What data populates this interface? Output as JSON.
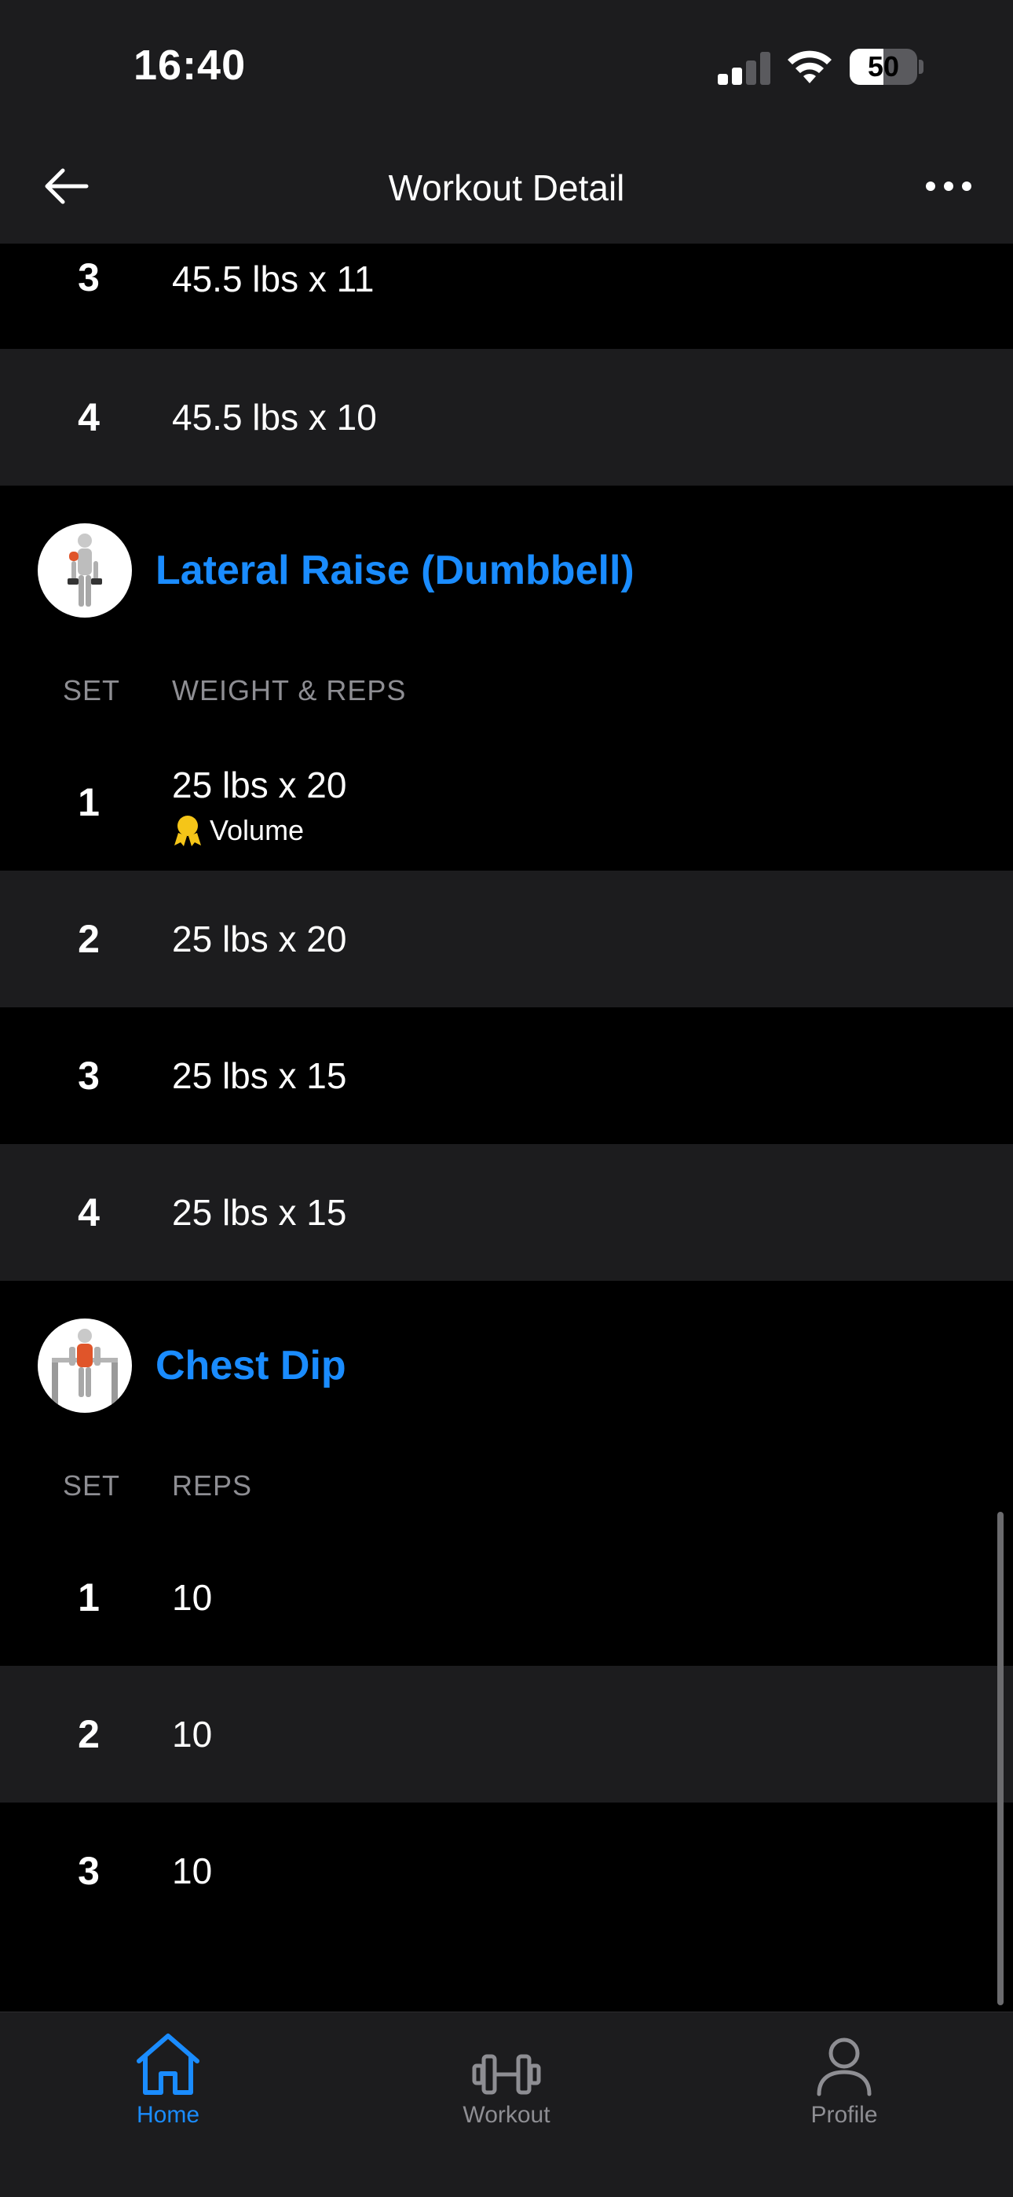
{
  "status": {
    "time": "16:40",
    "battery": "50",
    "battery_level": 0.5
  },
  "nav": {
    "title": "Workout Detail"
  },
  "prev_exercise_sets": [
    {
      "set": "3",
      "value": "45.5 lbs x 11"
    },
    {
      "set": "4",
      "value": "45.5 lbs x 10"
    }
  ],
  "exercises": [
    {
      "title": "Lateral Raise (Dumbbell)",
      "col_set": "SET",
      "col_value": "WEIGHT & REPS",
      "sets": [
        {
          "set": "1",
          "value": "25 lbs x 20",
          "badge": "Volume"
        },
        {
          "set": "2",
          "value": "25 lbs x 20"
        },
        {
          "set": "3",
          "value": "25 lbs x 15"
        },
        {
          "set": "4",
          "value": "25 lbs x 15"
        }
      ]
    },
    {
      "title": "Chest Dip",
      "col_set": "SET",
      "col_value": "REPS",
      "sets": [
        {
          "set": "1",
          "value": "10"
        },
        {
          "set": "2",
          "value": "10"
        },
        {
          "set": "3",
          "value": "10"
        }
      ]
    }
  ],
  "tabs": [
    {
      "label": "Home",
      "icon": "home-icon",
      "active": true
    },
    {
      "label": "Workout",
      "icon": "dumbbell-icon",
      "active": false
    },
    {
      "label": "Profile",
      "icon": "profile-icon",
      "active": false
    }
  ],
  "colors": {
    "accent": "#1a8cff",
    "row_alt": "#1c1c1e",
    "badge": "#f5c518"
  }
}
